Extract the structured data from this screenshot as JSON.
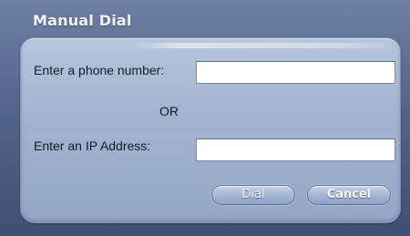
{
  "dialog": {
    "title": "Manual Dial",
    "phone_label": "Enter a phone number:",
    "phone_value": "",
    "separator": "OR",
    "ip_label": "Enter an IP Address:",
    "ip_value": "",
    "dial_label": "Dial",
    "cancel_label": "Cancel"
  },
  "colors": {
    "window_background": "#53658a",
    "panel_background": "#a3b5d0",
    "title_text": "#f2f5fb",
    "button_fill": "#a8b9d4",
    "button_text": "#f7f9fd",
    "field_background": "#ffffff"
  }
}
